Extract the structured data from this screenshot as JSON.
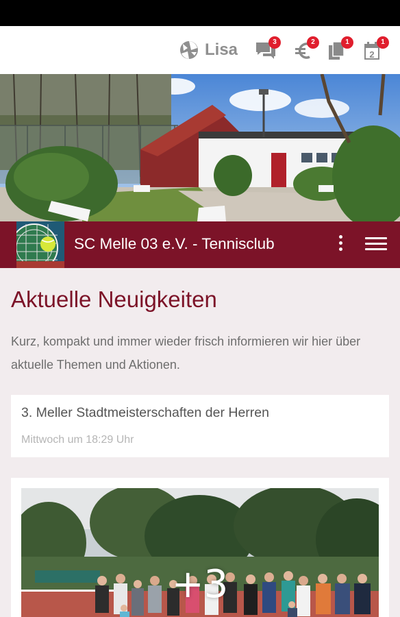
{
  "header": {
    "user_name": "Lisa",
    "icons": [
      {
        "name": "chat-icon",
        "badge": "3"
      },
      {
        "name": "euro-icon",
        "badge": "2"
      },
      {
        "name": "documents-icon",
        "badge": "1"
      },
      {
        "name": "calendar-icon",
        "badge": "1"
      }
    ]
  },
  "calendar_day": "2",
  "club": {
    "title": "SC Melle 03 e.V. - Tennisclub"
  },
  "main": {
    "heading": "Aktuelle Neuigkeiten",
    "intro": "Kurz, kompakt und immer wieder frisch informieren wir hier über aktuelle Themen und Aktionen."
  },
  "news": [
    {
      "title": "3. Meller Stadtmeisterschaften der Herren",
      "date": "Mittwoch um 18:29 Uhr"
    }
  ],
  "gallery": {
    "more_count": "+3"
  },
  "colors": {
    "brand": "#7c1328",
    "badge": "#e01e2d",
    "background": "#f2ecee"
  }
}
